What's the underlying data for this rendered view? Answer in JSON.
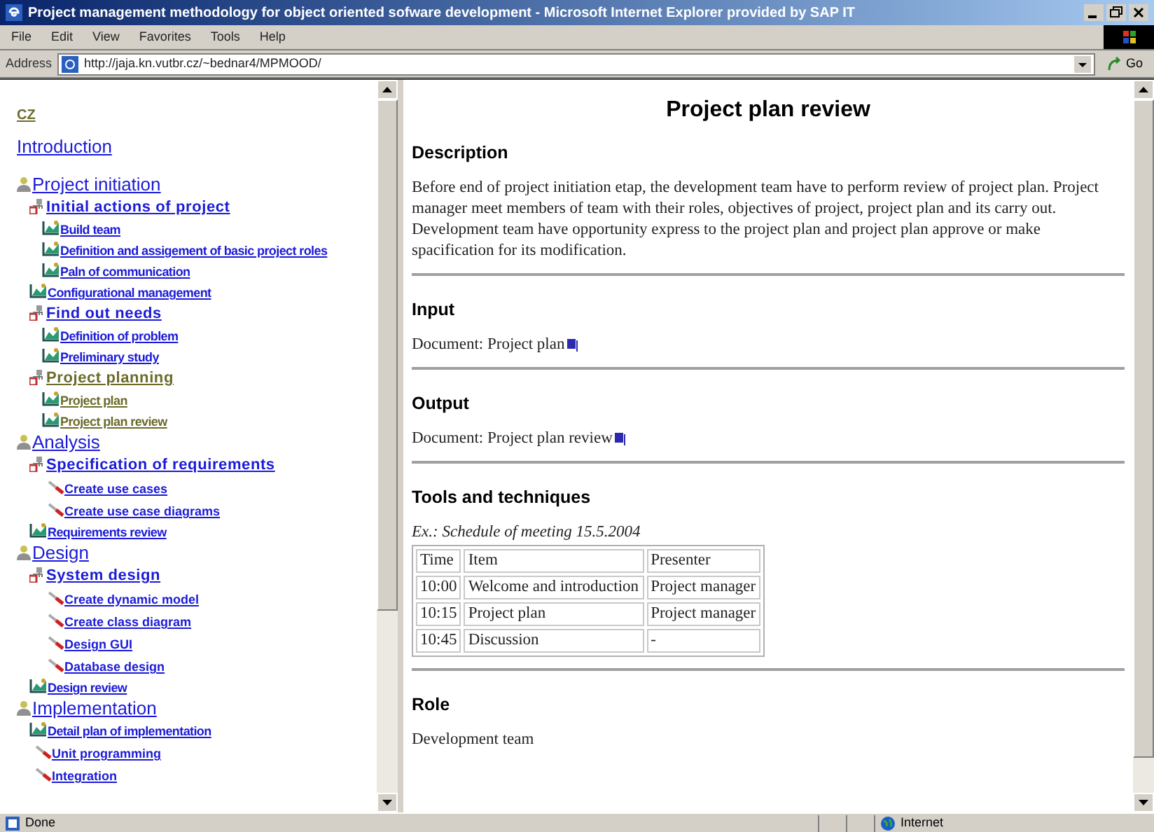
{
  "window": {
    "title": "Project management methodology for object oriented sofware development - Microsoft Internet Explorer provided by SAP IT"
  },
  "menu": [
    "File",
    "Edit",
    "View",
    "Favorites",
    "Tools",
    "Help"
  ],
  "address": {
    "label": "Address",
    "value": "http://jaja.kn.vutbr.cz/~bednar4/MPMOOD/",
    "go": "Go"
  },
  "nav": {
    "language_link": {
      "label": "CZ",
      "visited": true
    },
    "intro_link": {
      "label": "Introduction",
      "visited": false
    },
    "tree": [
      {
        "kind": "phase",
        "label": "Project initiation",
        "visited": false,
        "children": [
          {
            "kind": "activity",
            "label": "Initial actions of project",
            "visited": false,
            "children": [
              {
                "kind": "task",
                "label": "Build team",
                "visited": false
              },
              {
                "kind": "task",
                "label": "Definition and assigement of basic project roles",
                "visited": false
              },
              {
                "kind": "task",
                "label": "Paln of communication",
                "visited": false
              }
            ]
          },
          {
            "kind": "task",
            "label": "Configurational management",
            "visited": false
          },
          {
            "kind": "activity",
            "label": "Find out needs",
            "visited": false,
            "children": [
              {
                "kind": "task",
                "label": "Definition of problem",
                "visited": false
              },
              {
                "kind": "task",
                "label": "Preliminary study",
                "visited": false
              }
            ]
          },
          {
            "kind": "activity",
            "label": "Project planning",
            "visited": true,
            "children": [
              {
                "kind": "task",
                "label": "Project plan",
                "visited": true
              },
              {
                "kind": "task",
                "label": "Project plan review",
                "visited": true
              }
            ]
          }
        ]
      },
      {
        "kind": "phase",
        "label": "Analysis",
        "visited": false,
        "children": [
          {
            "kind": "activity",
            "label": "Specification of requirements",
            "visited": false,
            "children": [
              {
                "kind": "tool",
                "label": "Create use cases",
                "visited": false
              },
              {
                "kind": "tool",
                "label": "Create use case diagrams",
                "visited": false
              }
            ]
          },
          {
            "kind": "task",
            "label": "Requirements review",
            "visited": false
          }
        ]
      },
      {
        "kind": "phase",
        "label": "Design",
        "visited": false,
        "children": [
          {
            "kind": "activity",
            "label": "System design",
            "visited": false,
            "children": [
              {
                "kind": "tool",
                "label": "Create dynamic model",
                "visited": false
              },
              {
                "kind": "tool",
                "label": "Create class diagram",
                "visited": false
              },
              {
                "kind": "tool",
                "label": "Design GUI",
                "visited": false
              },
              {
                "kind": "tool",
                "label": "Database design",
                "visited": false
              }
            ]
          },
          {
            "kind": "task",
            "label": "Design review",
            "visited": false
          }
        ]
      },
      {
        "kind": "phase",
        "label": "Implementation",
        "visited": false,
        "children": [
          {
            "kind": "task",
            "label": "Detail plan of implementation",
            "visited": false
          },
          {
            "kind": "tool",
            "label": "Unit programming",
            "visited": false
          },
          {
            "kind": "tool",
            "label": "Integration",
            "visited": false
          }
        ]
      }
    ]
  },
  "content": {
    "title": "Project plan review",
    "sections": [
      {
        "kind": "text",
        "heading": "Description",
        "text": "Before end of project initiation etap, the development team have to perform review of project plan. Project manager meet members of team with their roles, objectives of project, project plan and its carry out. Development team have opportunity express to the project plan and project plan approve or make spacification for its modification."
      },
      {
        "kind": "document",
        "heading": "Input",
        "text": "Document: Project plan"
      },
      {
        "kind": "document",
        "heading": "Output",
        "text": "Document: Project plan review"
      },
      {
        "kind": "table",
        "heading": "Tools and techniques",
        "caption": "Ex.: Schedule of meeting 15.5.2004",
        "rows": [
          [
            "Time",
            "Item",
            "Presenter"
          ],
          [
            "10:00",
            "Welcome and introduction",
            "Project manager"
          ],
          [
            "10:15",
            "Project plan",
            "Project manager"
          ],
          [
            "10:45",
            "Discussion",
            "-"
          ]
        ]
      },
      {
        "kind": "text",
        "heading": "Role",
        "text": "Development team"
      }
    ]
  },
  "status_bar": {
    "text": "Done",
    "zone": "Internet"
  }
}
